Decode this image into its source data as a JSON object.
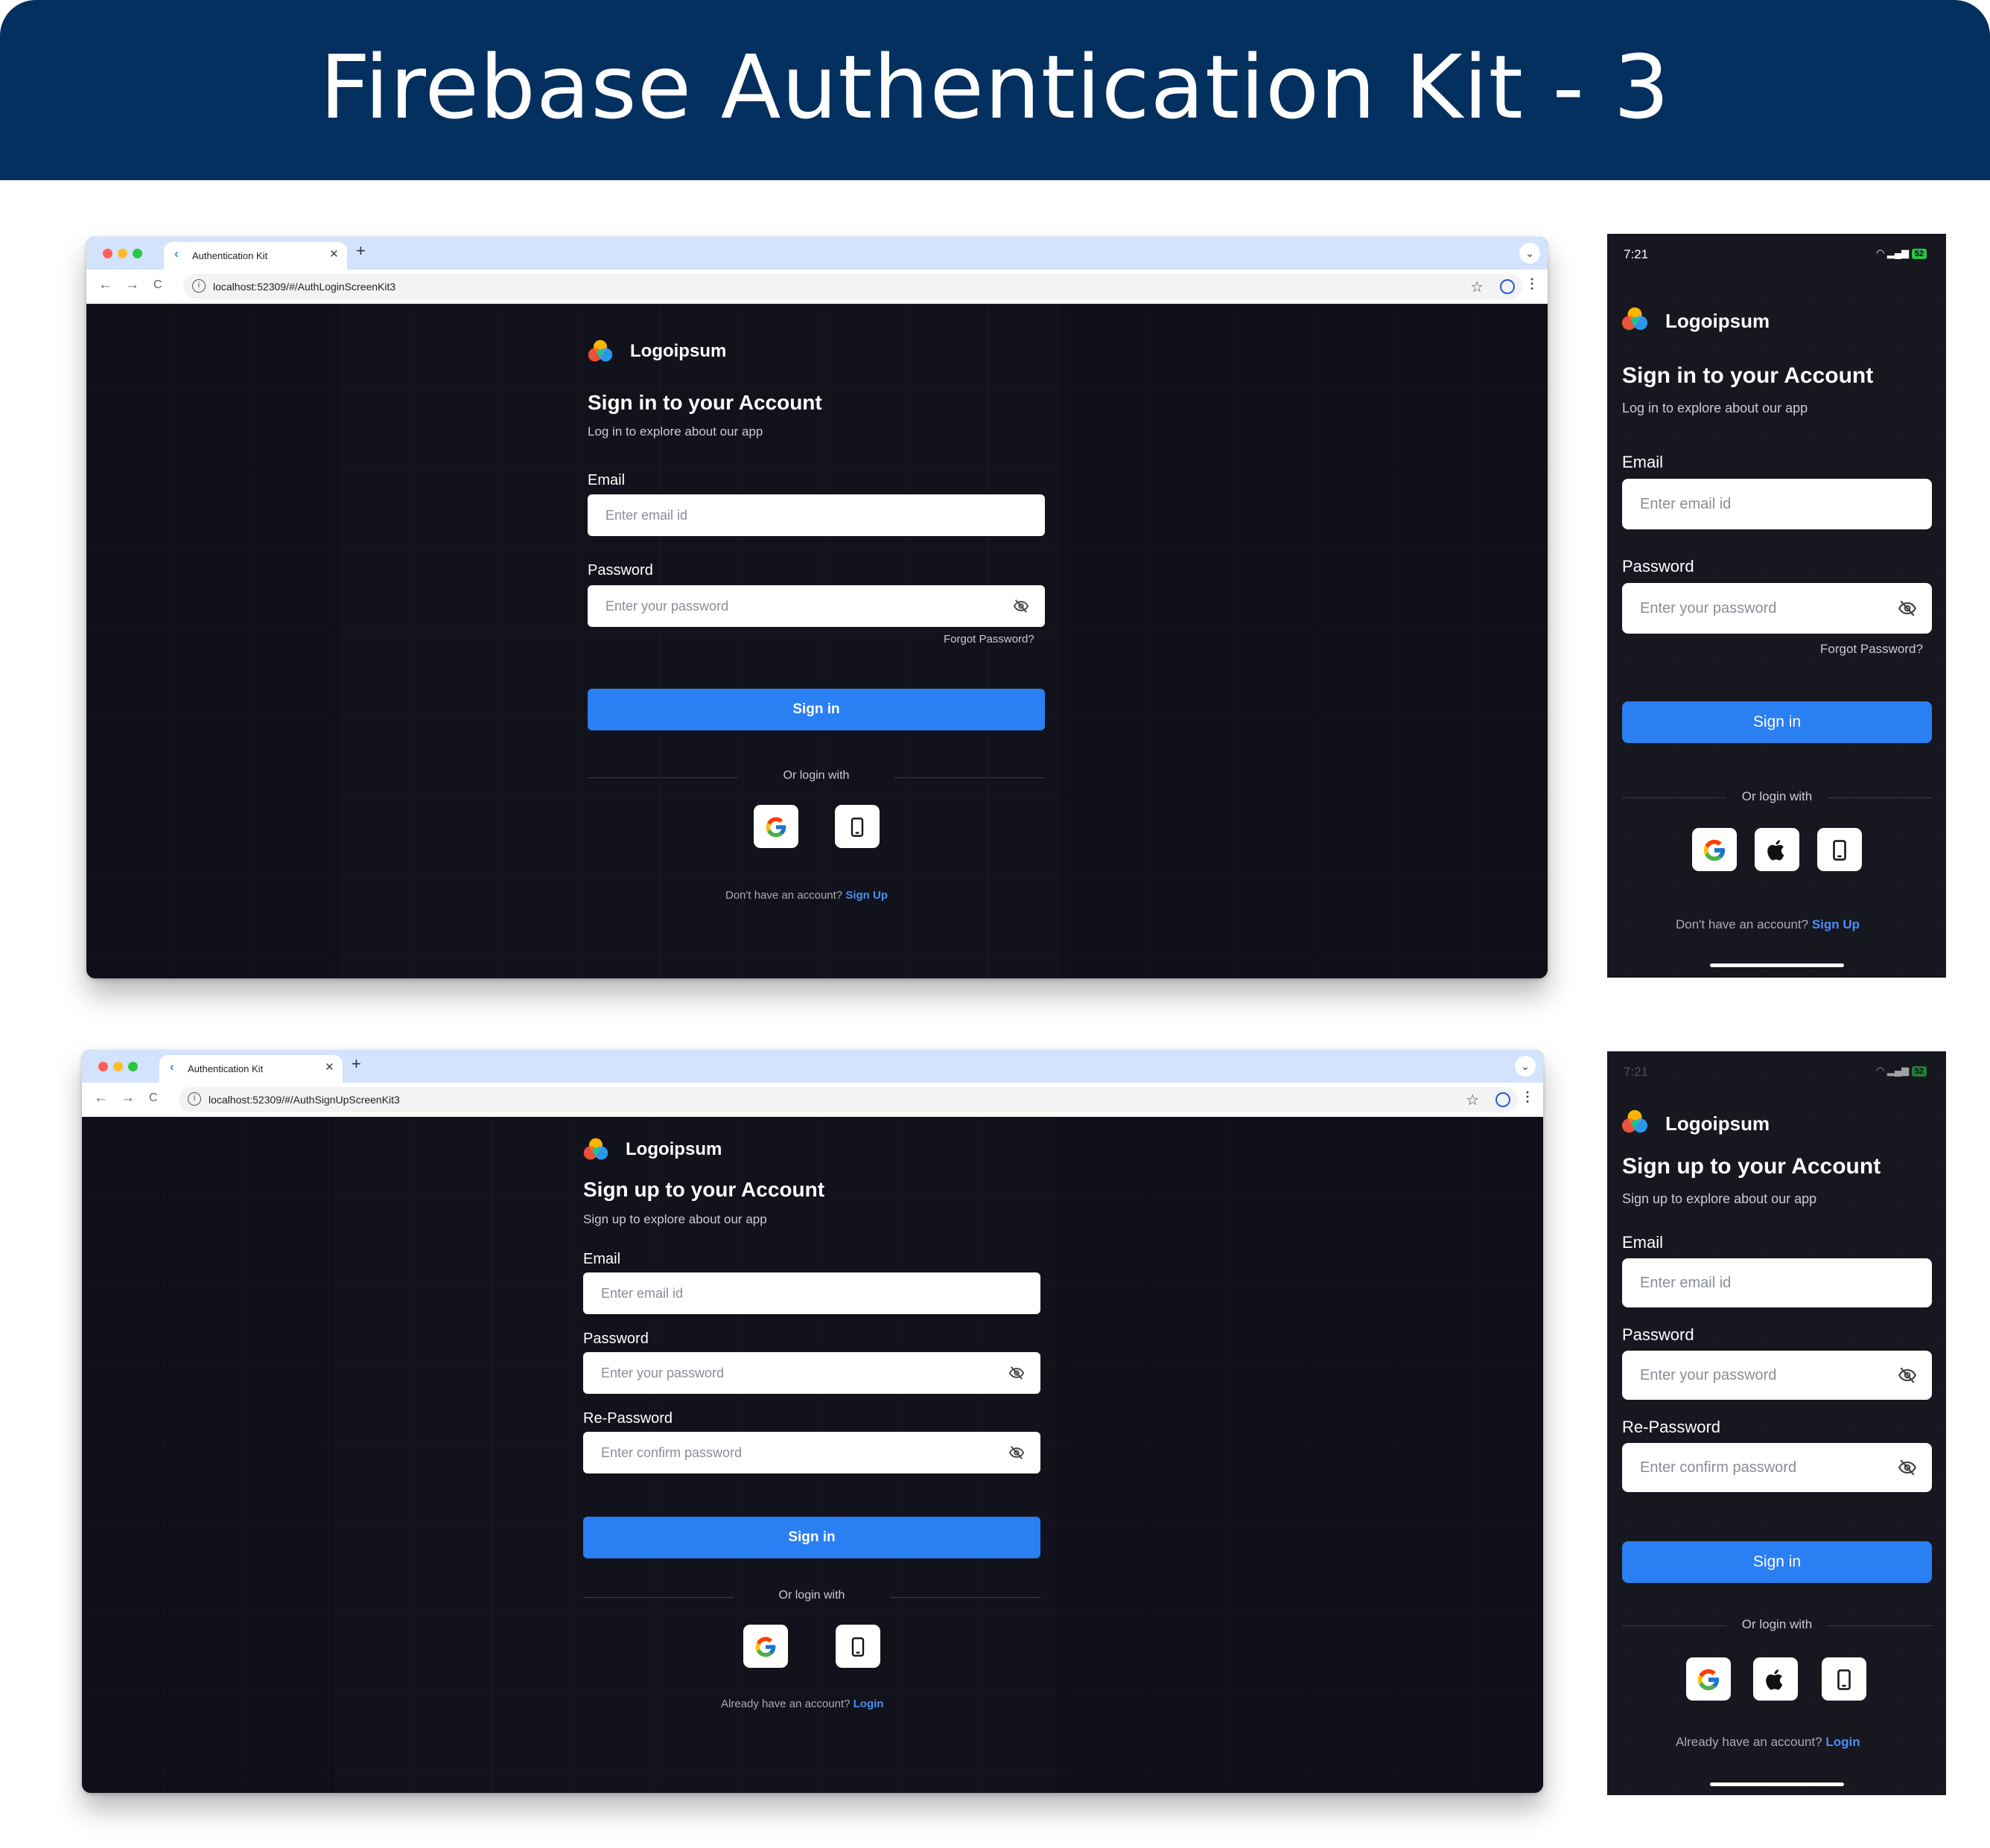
{
  "banner": {
    "title": "Firebase Authentication Kit - 3"
  },
  "browser_common": {
    "tab_title": "Authentication Kit",
    "close": "×",
    "new_tab": "+",
    "chevron": "⌄",
    "back": "←",
    "forward": "→",
    "reload": "C",
    "star": "☆",
    "menu": "⋮",
    "info": "i"
  },
  "login_web": {
    "url": "localhost:52309/#/AuthLoginScreenKit3",
    "logo": "Logoipsum",
    "title": "Sign in to your Account",
    "subtitle": "Log in to explore about our app",
    "email_label": "Email",
    "email_placeholder": "Enter email id",
    "password_label": "Password",
    "password_placeholder": "Enter your password",
    "forgot": "Forgot Password?",
    "button": "Sign in",
    "divider": "Or login with",
    "footer_text": "Don't have an account?",
    "footer_link": "Sign Up"
  },
  "signup_web": {
    "url": "localhost:52309/#/AuthSignUpScreenKit3",
    "logo": "Logoipsum",
    "title": "Sign up to your Account",
    "subtitle": "Sign up to explore about our app",
    "email_label": "Email",
    "email_placeholder": "Enter email id",
    "password_label": "Password",
    "password_placeholder": "Enter your password",
    "repassword_label": "Re-Password",
    "repassword_placeholder": "Enter confirm password",
    "button": "Sign in",
    "divider": "Or login with",
    "footer_text": "Already have an account?",
    "footer_link": "Login"
  },
  "login_mobile": {
    "time": "7:21",
    "battery": "52",
    "logo": "Logoipsum",
    "title": "Sign in to your Account",
    "subtitle": "Log in to explore about our app",
    "email_label": "Email",
    "email_placeholder": "Enter email id",
    "password_label": "Password",
    "password_placeholder": "Enter your password",
    "forgot": "Forgot Password?",
    "button": "Sign in",
    "divider": "Or login with",
    "footer_text": "Don't have an account?",
    "footer_link": "Sign Up"
  },
  "signup_mobile": {
    "time": "7:21",
    "battery": "52",
    "logo": "Logoipsum",
    "title": "Sign up to your Account",
    "subtitle": "Sign up to explore about our app",
    "email_label": "Email",
    "email_placeholder": "Enter email id",
    "password_label": "Password",
    "password_placeholder": "Enter your password",
    "repassword_label": "Re-Password",
    "repassword_placeholder": "Enter confirm password",
    "button": "Sign in",
    "divider": "Or login with",
    "footer_text": "Already have an account?",
    "footer_link": "Login"
  },
  "colors": {
    "banner": "#04305f",
    "primary": "#2a7ff3",
    "link": "#4b8ff6",
    "background": "#0e0f18"
  },
  "icons": [
    "logo-icon",
    "eye-off-icon",
    "google-icon",
    "apple-icon",
    "phone-icon"
  ]
}
